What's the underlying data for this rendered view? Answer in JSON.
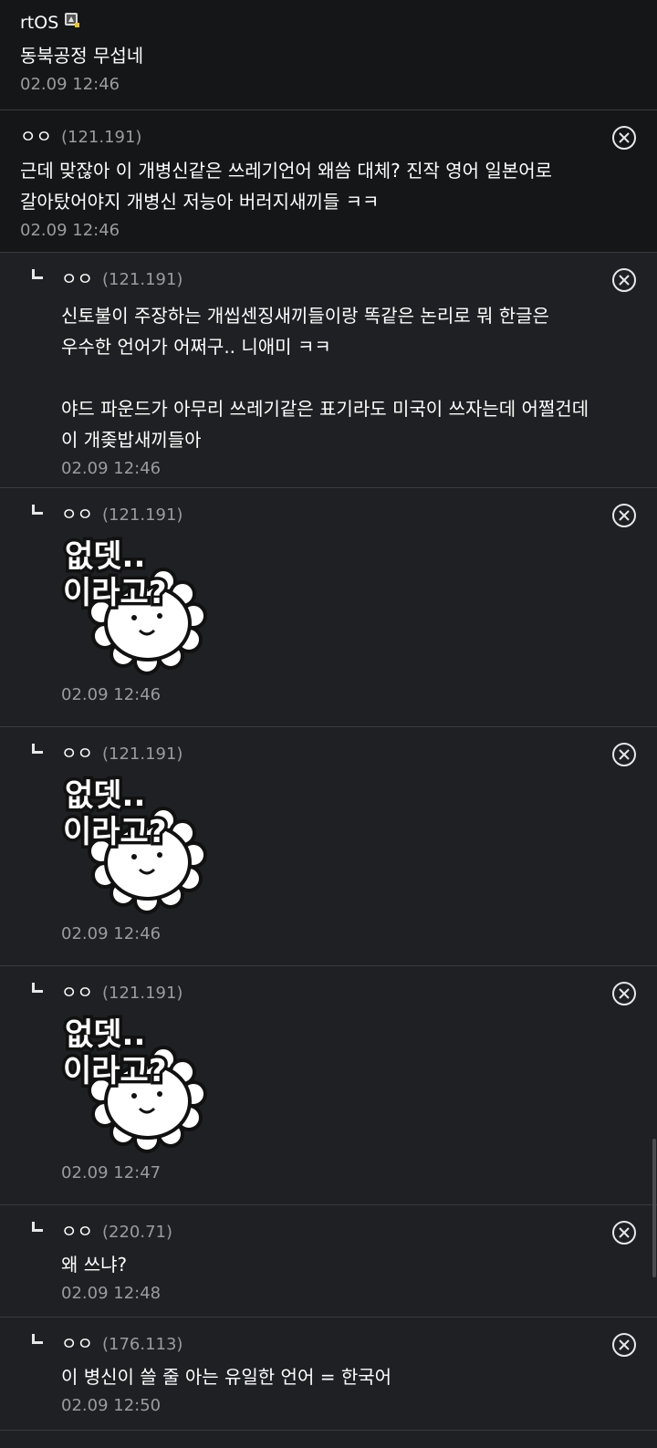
{
  "comments": [
    {
      "nick": "rtOS",
      "ip": "",
      "body": "동북공정 무섭네",
      "date": "02.09 12:46",
      "type": "top",
      "badge": "gallery-member-icon"
    },
    {
      "nick": "ㅇㅇ",
      "ip": "(121.191)",
      "body": "근데 맞잖아 이 개병신같은 쓰레기언어 왜씀 대체? 진작 영어 일본어로 갈아탔어야지 개병신 저능아 버러지새끼들 ㅋㅋ",
      "date": "02.09 12:46",
      "type": "top"
    },
    {
      "nick": "ㅇㅇ",
      "ip": "(121.191)",
      "body": "신토불이 주장하는 개씹센징새끼들이랑 똑같은 논리로 뭐 한글은 우수한 언어가 어쩌구.. 니애미 ㅋㅋ\n\n야드 파운드가 아무리 쓰레기같은 표기라도 미국이 쓰자는데 어쩔건데 이 개좆밥새끼들아",
      "date": "02.09 12:46",
      "type": "reply"
    },
    {
      "nick": "ㅇㅇ",
      "ip": "(121.191)",
      "sticker": {
        "line1": "없뎃..",
        "line2": "이라고?"
      },
      "date": "02.09 12:46",
      "type": "reply"
    },
    {
      "nick": "ㅇㅇ",
      "ip": "(121.191)",
      "sticker": {
        "line1": "없뎃..",
        "line2": "이라고?"
      },
      "date": "02.09 12:46",
      "type": "reply"
    },
    {
      "nick": "ㅇㅇ",
      "ip": "(121.191)",
      "sticker": {
        "line1": "없뎃..",
        "line2": "이라고?"
      },
      "date": "02.09 12:47",
      "type": "reply"
    },
    {
      "nick": "ㅇㅇ",
      "ip": "(220.71)",
      "body": "왜 쓰냐?",
      "date": "02.09 12:48",
      "type": "reply"
    },
    {
      "nick": "ㅇㅇ",
      "ip": "(176.113)",
      "body": "이 병신이 쓸 줄 아는 유일한 언어 = 한국어",
      "date": "02.09 12:50",
      "type": "reply"
    }
  ],
  "colors": {
    "bg": "#1f2023",
    "top_bg": "#151617",
    "meta": "#9a9b9e",
    "divider": "#3a3b3e"
  },
  "icons": {
    "delete": "close-circle-icon",
    "reply": "reply-arrow-icon",
    "sticker": "lion-sticker-image"
  }
}
